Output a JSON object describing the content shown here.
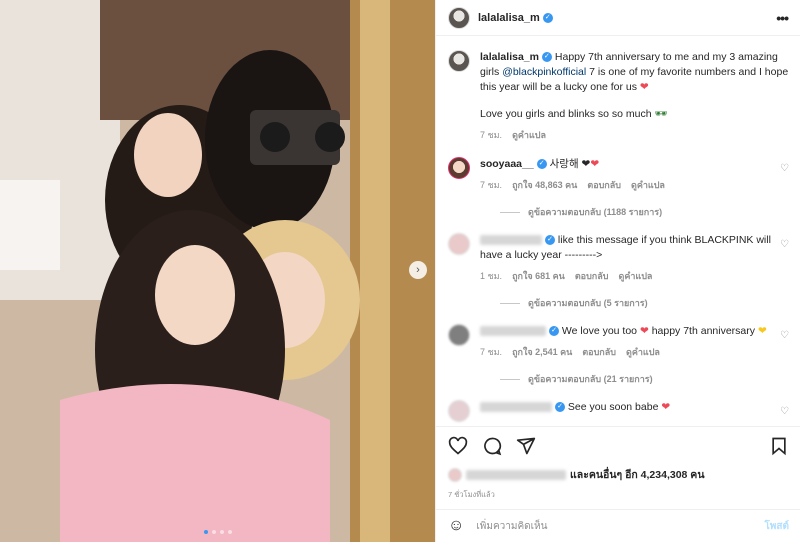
{
  "post": {
    "username": "lalalalisa_m",
    "caption_text_1": "Happy 7th anniversary to me and my 3 amazing girls",
    "caption_mention": "@blackpinkofficial",
    "caption_text_2": "7 is one of my favorite numbers and I hope this year will be a lucky one for us",
    "caption_line2": "Love you girls and blinks so so much",
    "caption_time": "7 ชม.",
    "caption_translate": "ดูคำแปล"
  },
  "comments": [
    {
      "username": "sooyaaa__",
      "text": "사랑해",
      "time": "7 ชม.",
      "likes": "ถูกใจ 48,863 คน",
      "reply": "ตอบกลับ",
      "translate": "ดูคำแปล",
      "replies": "ดูข้อความตอบกลับ (1188 รายการ)"
    },
    {
      "username": "",
      "text": "like this message if you think BLACKPINK will have a lucky year --------->",
      "time": "1 ชม.",
      "likes": "ถูกใจ 681 คน",
      "reply": "ตอบกลับ",
      "translate": "ดูคำแปล",
      "replies": "ดูข้อความตอบกลับ (5 รายการ)"
    },
    {
      "username": "",
      "text_1": "We love you too",
      "text_2": "happy 7th anniversary",
      "time": "7 ชม.",
      "likes": "ถูกใจ 2,541 คน",
      "reply": "ตอบกลับ",
      "translate": "ดูคำแปล",
      "replies": "ดูข้อความตอบกลับ (21 รายการ)"
    },
    {
      "username": "",
      "text": "See you soon babe"
    }
  ],
  "likes_text": "และคนอื่นๆ อีก 4,234,308 คน",
  "date_text": "7 ชั่วโมงที่แล้ว",
  "add_comment_placeholder": "เพิ่มความคิดเห็น",
  "post_button": "โพสต์",
  "colors": {
    "accent": "#3897f0",
    "heart": "#ed4956"
  }
}
